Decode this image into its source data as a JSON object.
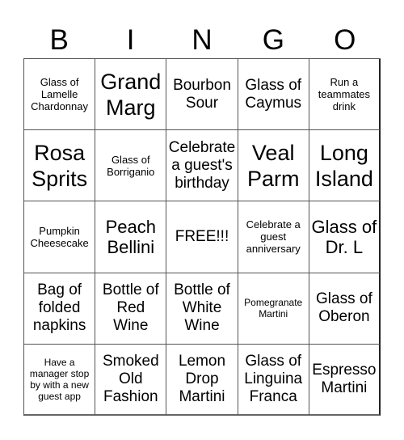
{
  "header": [
    "B",
    "I",
    "N",
    "G",
    "O"
  ],
  "cells": [
    {
      "text": "Glass of Lamelle Chardonnay",
      "size": "sm"
    },
    {
      "text": "Grand Marg",
      "size": "xl"
    },
    {
      "text": "Bourbon Sour",
      "size": "md"
    },
    {
      "text": "Glass of Caymus",
      "size": "md"
    },
    {
      "text": "Run a teammates drink",
      "size": "sm"
    },
    {
      "text": "Rosa Sprits",
      "size": "xl"
    },
    {
      "text": "Glass of Borriganio",
      "size": "sm"
    },
    {
      "text": "Celebrate a guest's birthday",
      "size": "md"
    },
    {
      "text": "Veal Parm",
      "size": "xl"
    },
    {
      "text": "Long Island",
      "size": "xl"
    },
    {
      "text": "Pumpkin Cheesecake",
      "size": "sm"
    },
    {
      "text": "Peach Bellini",
      "size": "lg"
    },
    {
      "text": "FREE!!!",
      "size": "md"
    },
    {
      "text": "Celebrate a guest anniversary",
      "size": "sm"
    },
    {
      "text": "Glass of Dr. L",
      "size": "lg"
    },
    {
      "text": "Bag of folded napkins",
      "size": "md"
    },
    {
      "text": "Bottle of Red Wine",
      "size": "md"
    },
    {
      "text": "Bottle of White Wine",
      "size": "md"
    },
    {
      "text": "Pomegranate Martini",
      "size": "xs"
    },
    {
      "text": "Glass of Oberon",
      "size": "md"
    },
    {
      "text": "Have a manager stop by with a new guest app",
      "size": "xs"
    },
    {
      "text": "Smoked Old Fashion",
      "size": "md"
    },
    {
      "text": "Lemon Drop Martini",
      "size": "md"
    },
    {
      "text": "Glass of Linguina Franca",
      "size": "md"
    },
    {
      "text": "Espresso Martini",
      "size": "md"
    }
  ]
}
